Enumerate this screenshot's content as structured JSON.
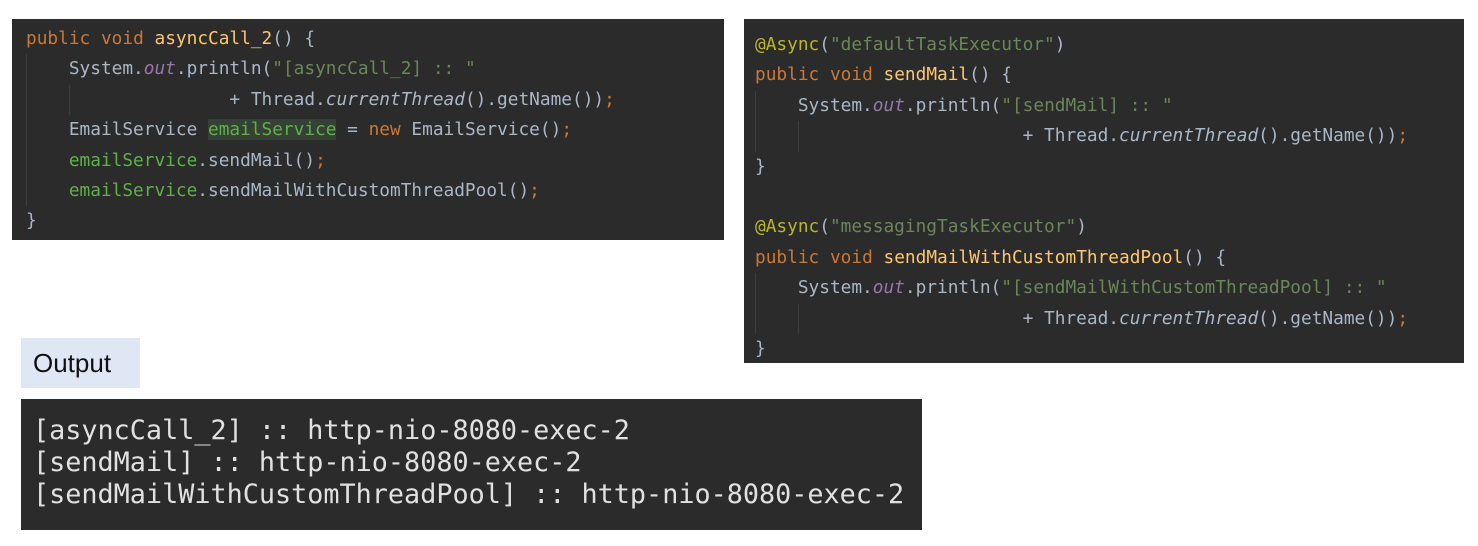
{
  "left_code": {
    "method_signature": {
      "kw_public": "public",
      "kw_void": "void",
      "name": "asyncCall_2",
      "rest": "() {"
    },
    "println_line": {
      "prefix": "System.",
      "static_out": "out",
      "call": ".println(",
      "string": "\"[asyncCall_2] :: \""
    },
    "concat_line": {
      "plus": "+ Thread.",
      "method": "currentThread",
      "rest": "().getName())",
      "semi": ";"
    },
    "decl_line": {
      "type": "EmailService ",
      "var": "emailService",
      "assign": " = ",
      "kw_new": "new",
      "ctor": " EmailService()",
      "semi": ";"
    },
    "call1_line": {
      "var": "emailService",
      "call": ".sendMail()",
      "semi": ";"
    },
    "call2_line": {
      "var": "emailService",
      "call": ".sendMailWithCustomThreadPool()",
      "semi": ";"
    },
    "closing": "}"
  },
  "right_code": {
    "method1": {
      "annotation": "@Async",
      "ann_open": "(",
      "ann_arg": "\"defaultTaskExecutor\"",
      "ann_close": ")",
      "kw_public": "public",
      "kw_void": "void",
      "name": "sendMail",
      "rest": "() {",
      "println_prefix": "System.",
      "static_out": "out",
      "println_call": ".println(",
      "string": "\"[sendMail] :: \"",
      "plus": "+ Thread.",
      "method": "currentThread",
      "tail": "().getName())",
      "semi": ";",
      "closing": "}"
    },
    "method2": {
      "annotation": "@Async",
      "ann_open": "(",
      "ann_arg": "\"messagingTaskExecutor\"",
      "ann_close": ")",
      "kw_public": "public",
      "kw_void": "void",
      "name": "sendMailWithCustomThreadPool",
      "rest": "() {",
      "println_prefix": "System.",
      "static_out": "out",
      "println_call": ".println(",
      "string": "\"[sendMailWithCustomThreadPool] :: \"",
      "plus": "+ Thread.",
      "method": "currentThread",
      "tail": "().getName())",
      "semi": ";",
      "closing": "}"
    }
  },
  "output_label": "Output",
  "output_lines": [
    "[asyncCall_2] :: http-nio-8080-exec-2",
    "[sendMail] :: http-nio-8080-exec-2",
    "[sendMailWithCustomThreadPool] :: http-nio-8080-exec-2"
  ],
  "colors": {
    "editor_background": "#2b2b2b",
    "keyword": "#cc7832",
    "function_name": "#ffc66d",
    "string": "#6a8759",
    "static_field": "#9876aa",
    "annotation": "#bbb529",
    "local_field": "#5fb04a",
    "default_text": "#a9b7c6",
    "output_label_background": "#dfe7f4"
  }
}
